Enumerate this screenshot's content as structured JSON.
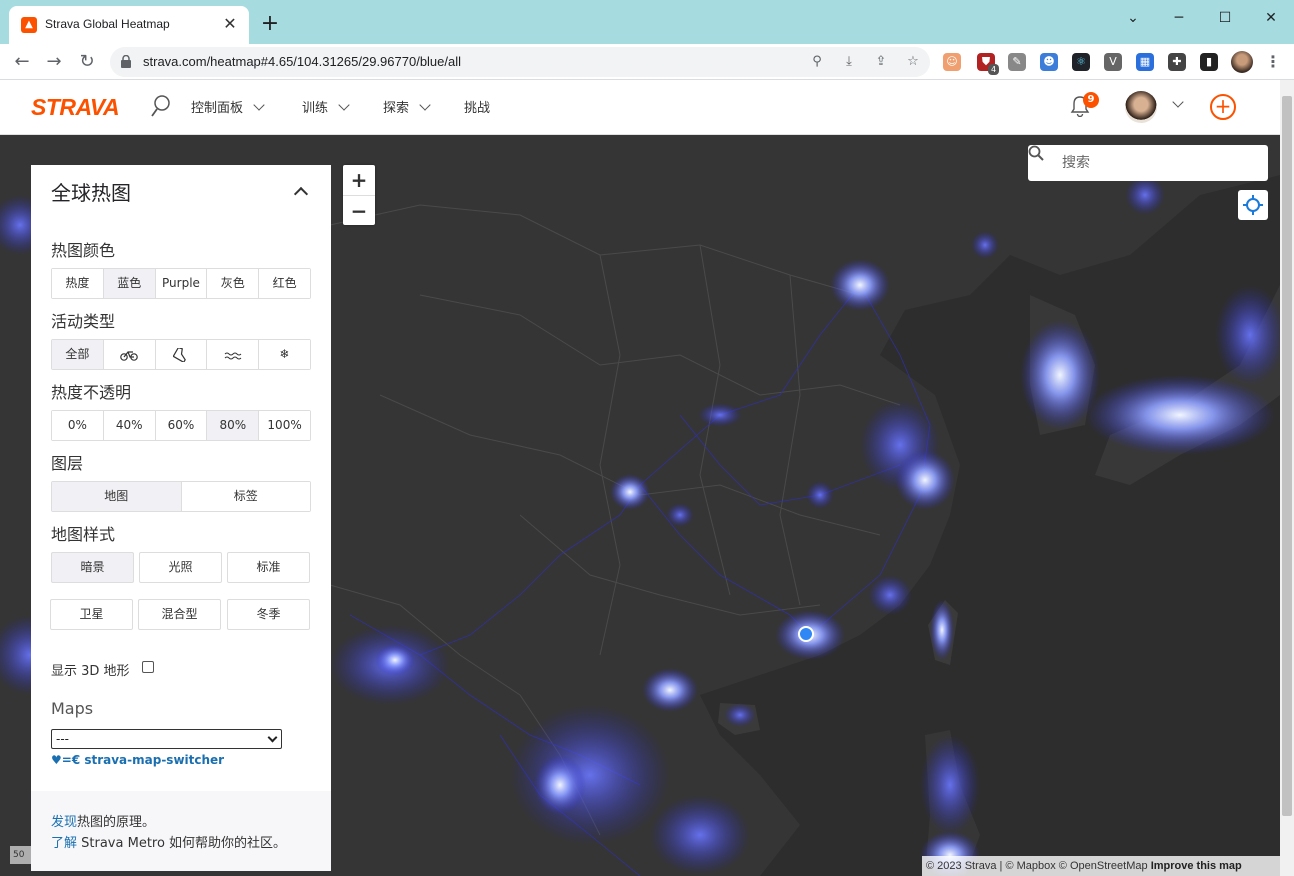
{
  "browser": {
    "tab_title": "Strava Global Heatmap",
    "favicon_letter": "▲",
    "url": "strava.com/heatmap#4.65/104.31265/29.96770/blue/all",
    "extension_badge": "4"
  },
  "header": {
    "logo": "STRAVA",
    "menu": [
      "控制面板",
      "训练",
      "探索",
      "挑战"
    ],
    "notification_count": "9",
    "upload_icon": "+"
  },
  "panel": {
    "title": "全球热图",
    "heatmap_color": {
      "label": "热图颜色",
      "options": [
        "热度",
        "蓝色",
        "Purple",
        "灰色",
        "红色"
      ],
      "selected": "蓝色"
    },
    "activity_type": {
      "label": "活动类型",
      "options": [
        "全部",
        "ride-icon",
        "run-icon",
        "water-icon",
        "winter-icon"
      ],
      "first_label": "全部",
      "selected": "全部"
    },
    "opacity": {
      "label": "热度不透明",
      "options": [
        "0%",
        "40%",
        "60%",
        "80%",
        "100%"
      ],
      "selected": "80%"
    },
    "layers": {
      "label": "图层",
      "options": [
        "地图",
        "标签"
      ],
      "selected": "地图"
    },
    "map_style": {
      "label": "地图样式",
      "options": [
        "暗景",
        "光照",
        "标准",
        "卫星",
        "混合型",
        "冬季"
      ],
      "selected": "暗景"
    },
    "terrain_label": "显示 3D 地形",
    "terrain_checked": false,
    "maps_label": "Maps",
    "maps_select_value": "---",
    "switcher_link": "♥=€ strava-map-switcher",
    "footer": {
      "line1_link": "发现",
      "line1_text": "热图的原理。",
      "line2_link": "了解",
      "line2_text": " Strava Metro 如何帮助你的社区。"
    }
  },
  "map": {
    "search_placeholder": "搜索",
    "zoom_in": "+",
    "zoom_out": "−",
    "attribution_text": "© 2023 Strava | © Mapbox © OpenStreetMap ",
    "attribution_improve": "Improve this map",
    "scale_label": "50",
    "heat_color": "#3a3ad8",
    "heat_hot_color": "#e8f0ff"
  }
}
